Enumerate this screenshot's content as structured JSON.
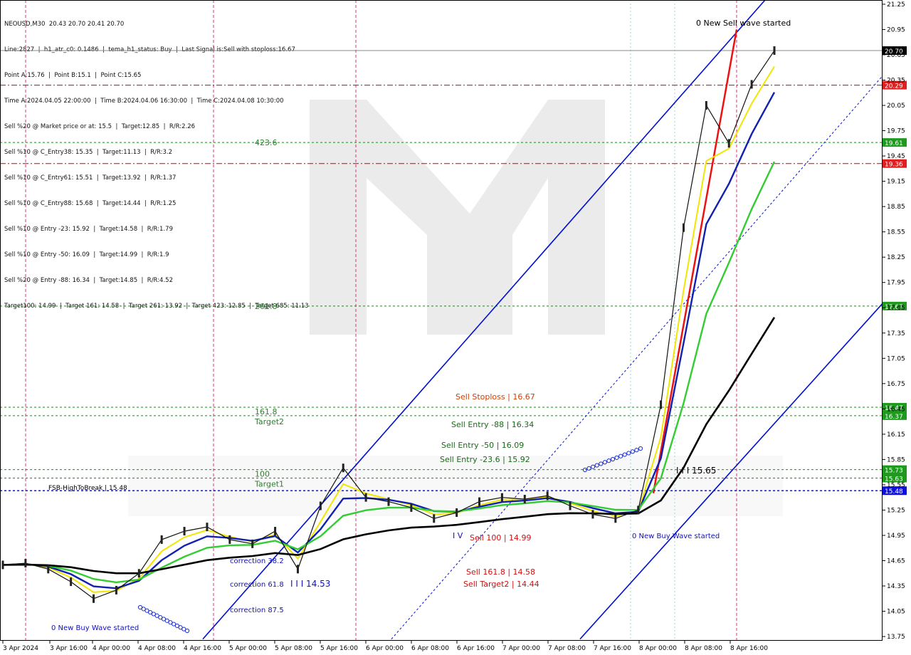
{
  "header": {
    "symbol_line": "NEOUSD,M30  20.43 20.70 20.41 20.70",
    "lines": [
      "Line:2827  |  h1_atr_c0: 0.1486  |  tema_h1_status: Buy  |  Last Signal is:Sell with stoploss:16.67",
      "Point A:15.76  |  Point B:15.1  |  Point C:15.65",
      "Time A:2024.04.05 22:00:00  |  Time B:2024.04.06 16:30:00  |  Time C:2024.04.08 10:30:00",
      "Sell %20 @ Market price or at: 15.5  |  Target:12.85  |  R/R:2.26",
      "Sell %10 @ C_Entry38: 15.35  |  Target:11.13  |  R/R:3.2",
      "Sell %10 @ C_Entry61: 15.51  |  Target:13.92  |  R/R:1.37",
      "Sell %10 @ C_Entry88: 15.68  |  Target:14.44  |  R/R:1.25",
      "Sell %10 @ Entry -23: 15.92  |  Target:14.58  |  R/R:1.79",
      "Sell %10 @ Entry -50: 16.09  |  Target:14.99  |  R/R:1.9",
      "Sell %20 @ Entry -88: 16.34  |  Target:14.85  |  R/R:4.52",
      "Target100: 14.99  |  Target 161: 14.58  |  Target 261: 13.92  |  Target 423: 12.85  |  Target 685: 11.13"
    ]
  },
  "chart_data": {
    "type": "line",
    "symbol": "NEOUSD",
    "timeframe": "M30",
    "ylim": [
      13.7,
      21.3
    ],
    "y_ticks": [
      13.75,
      14.05,
      14.35,
      14.65,
      14.95,
      15.25,
      15.55,
      15.85,
      16.15,
      16.45,
      16.75,
      17.05,
      17.35,
      17.65,
      17.95,
      18.25,
      18.55,
      18.85,
      19.15,
      19.45,
      19.75,
      20.05,
      20.35,
      20.65,
      20.95,
      21.25
    ],
    "x_ticks": [
      "3 Apr 2024",
      "3 Apr 16:00",
      "4 Apr 00:00",
      "4 Apr 08:00",
      "4 Apr 16:00",
      "5 Apr 00:00",
      "5 Apr 08:00",
      "5 Apr 16:00",
      "6 Apr 00:00",
      "6 Apr 08:00",
      "6 Apr 16:00",
      "7 Apr 00:00",
      "7 Apr 08:00",
      "7 Apr 16:00",
      "8 Apr 00:00",
      "8 Apr 08:00",
      "8 Apr 16:00"
    ],
    "price_series": {
      "x_index": [
        0,
        1,
        2,
        3,
        4,
        5,
        6,
        7,
        8,
        9,
        10,
        11,
        12,
        13,
        14,
        15,
        16,
        17,
        18,
        19,
        20,
        21,
        22,
        23,
        24,
        25,
        26,
        27,
        28,
        29,
        30,
        31,
        32,
        33,
        34
      ],
      "close": [
        14.6,
        14.62,
        14.55,
        14.4,
        14.2,
        14.3,
        14.5,
        14.9,
        15.0,
        15.05,
        14.9,
        14.85,
        15.0,
        14.55,
        15.3,
        15.75,
        15.4,
        15.35,
        15.28,
        15.15,
        15.22,
        15.35,
        15.4,
        15.38,
        15.42,
        15.3,
        15.2,
        15.15,
        15.25,
        16.5,
        18.6,
        20.05,
        19.6,
        20.3,
        20.7
      ]
    },
    "horizontal_levels": [
      {
        "value": 20.7,
        "label": "20.70",
        "style": "current"
      },
      {
        "value": 20.29,
        "label": "20.29",
        "style": "red-dashdot"
      },
      {
        "value": 19.61,
        "label": "19.61",
        "style": "green-dashed"
      },
      {
        "value": 19.36,
        "label": "19.36",
        "style": "red-dashdot"
      },
      {
        "value": 17.67,
        "label": "17.67",
        "style": "green-dashed"
      },
      {
        "value": 16.47,
        "label": "16.47",
        "style": "green-dashed"
      },
      {
        "value": 16.37,
        "label": "16.37",
        "style": "green-dashed"
      },
      {
        "value": 15.73,
        "label": "15.73",
        "style": "green-dashed"
      },
      {
        "value": 15.63,
        "label": "15.63",
        "style": "green-dashed"
      },
      {
        "value": 15.48,
        "label": "15.48",
        "style": "blue-dashed"
      }
    ],
    "fib_labels": [
      {
        "text": "423.6",
        "value": 19.61
      },
      {
        "text": "261.8",
        "value": 17.67
      },
      {
        "text": "161.8",
        "value": 16.42
      },
      {
        "text": "Target2",
        "value": 16.3
      },
      {
        "text": "100",
        "value": 15.68
      },
      {
        "text": "Target1",
        "value": 15.56
      }
    ],
    "annotations": [
      "0 New Sell wave started",
      "Sell Stoploss | 16.67",
      "Sell Entry -88 | 16.34",
      "Sell Entry -50 | 16.09",
      "Sell Entry -23.6 | 15.92",
      "I I I 15.65",
      "FSB-HighToBreak | 15.48",
      "Sell 100 | 14.99",
      "Sell 161.8 | 14.58",
      "Sell Target2 | 14.44",
      "0 New Buy Wave started",
      "0 New Buy Wave started",
      "correction 38.2",
      "correction 61.8",
      "correction 87.5",
      "I I I 14.53",
      "I V"
    ]
  }
}
